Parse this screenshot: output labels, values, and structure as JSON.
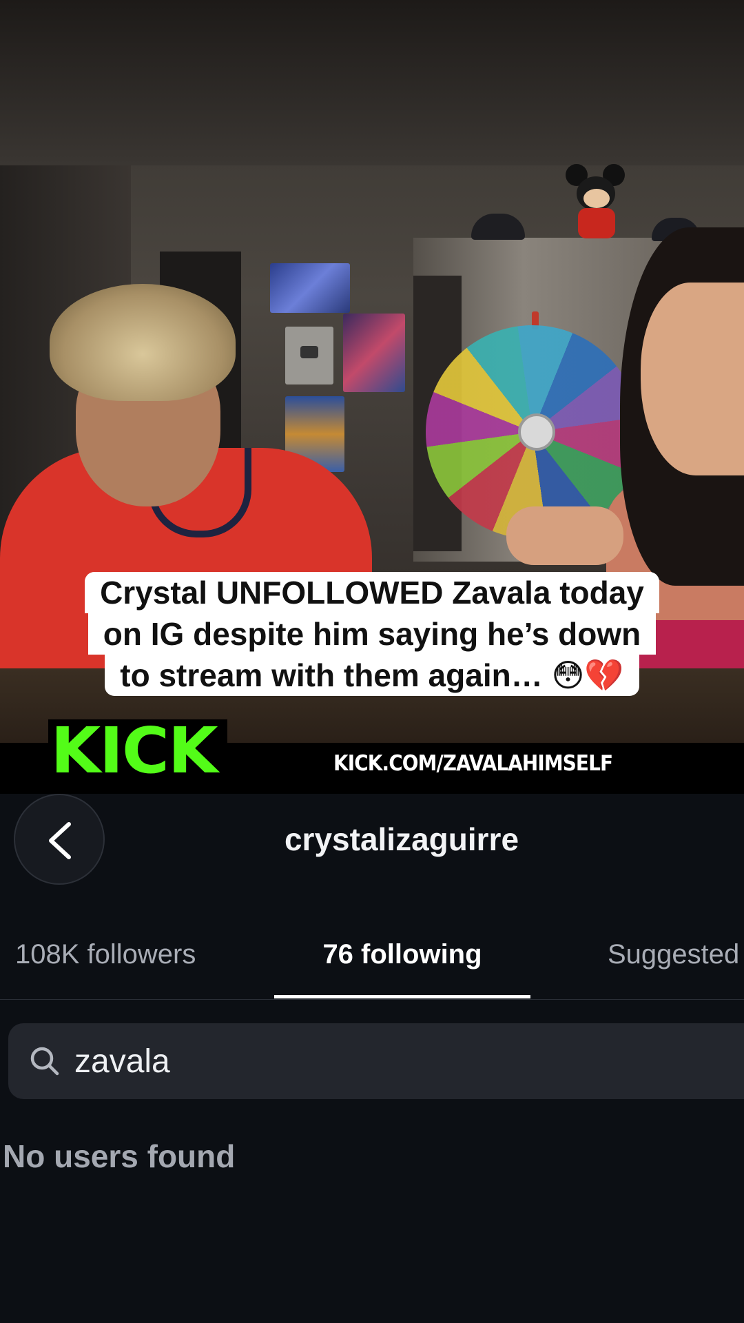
{
  "video": {
    "caption_lines": [
      "Crystal UNFOLLOWED Zavala today",
      "on IG despite him saying he’s down",
      "to stream with them again… 😳💔"
    ],
    "kick_logo": "KICK",
    "kick_url": "KICK.COM/ZAVALAHIMSELF",
    "kick_color": "#53fc18"
  },
  "header": {
    "back_icon": "chevron-left-icon",
    "username": "crystalizaguirre"
  },
  "tabs": [
    {
      "label": "108K followers",
      "active": false
    },
    {
      "label": "76 following",
      "active": true
    },
    {
      "label": "Suggested",
      "active": false
    }
  ],
  "search": {
    "icon": "search-icon",
    "value": "zavala"
  },
  "results": {
    "empty_message": "No users found"
  },
  "colors": {
    "background": "#0c0f14",
    "search_bg": "#23262d",
    "active_tab": "#ffffff",
    "inactive_tab": "#a9adb6"
  }
}
